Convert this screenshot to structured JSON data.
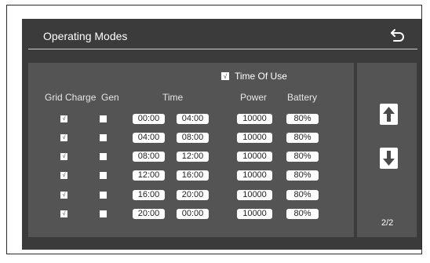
{
  "header": {
    "title": "Operating Modes"
  },
  "time_of_use": {
    "label": "Time Of Use",
    "checked": true
  },
  "columns": {
    "grid_charge": "Grid Charge",
    "gen": "Gen",
    "time": "Time",
    "power": "Power",
    "battery": "Battery"
  },
  "rows": [
    {
      "grid_charge": "√",
      "gen": "",
      "start": "00:00",
      "end": "04:00",
      "power": "10000",
      "battery": "80%"
    },
    {
      "grid_charge": "√",
      "gen": "",
      "start": "04:00",
      "end": "08:00",
      "power": "10000",
      "battery": "80%"
    },
    {
      "grid_charge": "√",
      "gen": "",
      "start": "08:00",
      "end": "12:00",
      "power": "10000",
      "battery": "80%"
    },
    {
      "grid_charge": "√",
      "gen": "",
      "start": "12:00",
      "end": "16:00",
      "power": "10000",
      "battery": "80%"
    },
    {
      "grid_charge": "√",
      "gen": "",
      "start": "16:00",
      "end": "20:00",
      "power": "10000",
      "battery": "80%"
    },
    {
      "grid_charge": "√",
      "gen": "",
      "start": "20:00",
      "end": "00:00",
      "power": "10000",
      "battery": "80%"
    }
  ],
  "pagination": {
    "page": "2/2"
  },
  "icons": {
    "back": "back-arrow-icon",
    "up": "arrow-up-icon",
    "down": "arrow-down-icon"
  }
}
